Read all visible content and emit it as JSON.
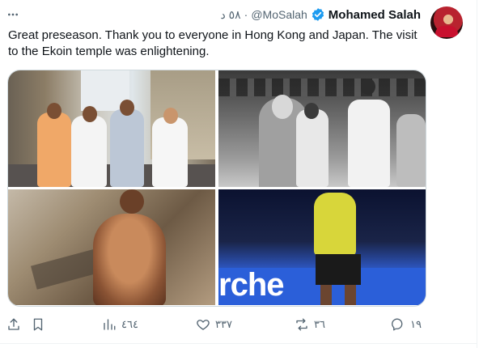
{
  "tweet": {
    "author_name": "Mohamed Salah",
    "handle": "@MoSalah",
    "dot": "·",
    "time": "٥٨ د",
    "text": "Great preseason. Thank you to everyone in Hong Kong and Japan. The visit to the Ekoin temple was enlightening.",
    "verified": true
  },
  "media": {
    "banner_fragment": "rche"
  },
  "actions": {
    "replies": "١٩",
    "reposts": "٣٦",
    "likes": "٣٣٧",
    "views": "٤٦٤"
  },
  "colors": {
    "text": "#0f1419",
    "secondary": "#536471",
    "verified": "#1d9bf0",
    "border": "#cfd9de"
  },
  "icons": [
    "more-icon",
    "verified-icon",
    "reply-icon",
    "repost-icon",
    "like-icon",
    "views-icon",
    "bookmark-icon",
    "share-icon"
  ]
}
